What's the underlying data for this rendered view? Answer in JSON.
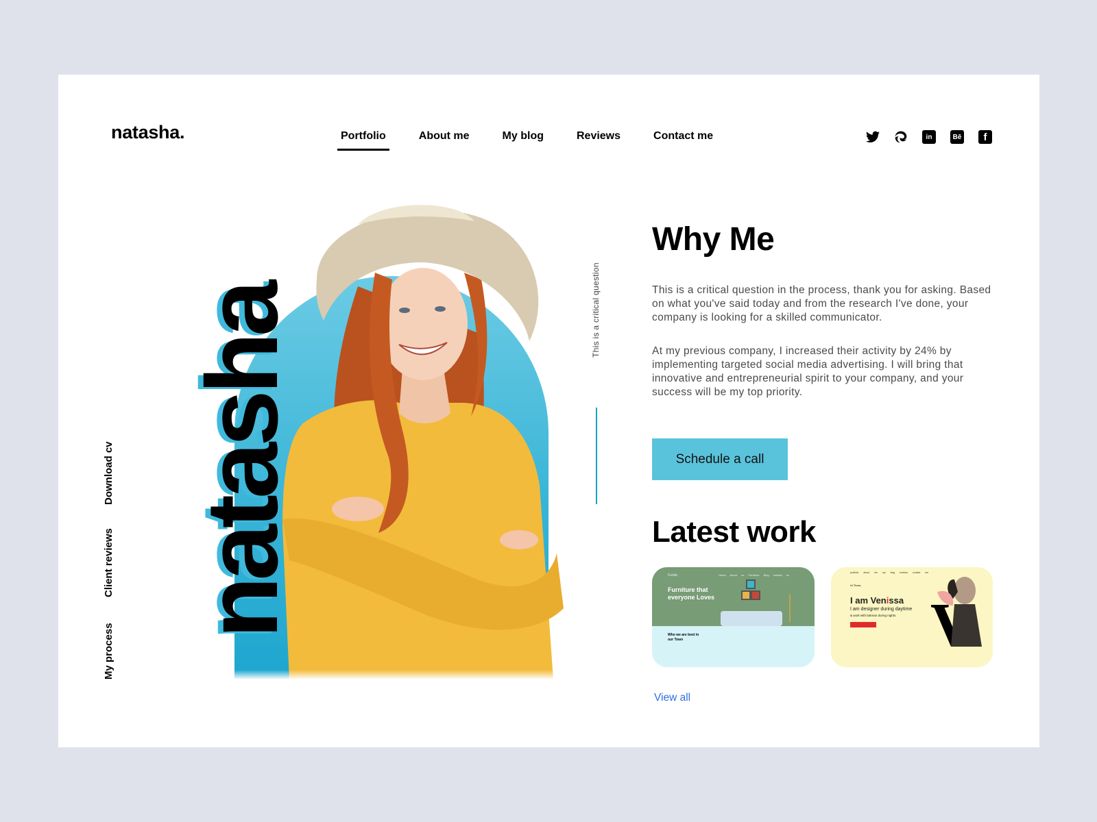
{
  "brand": {
    "logo": "natasha."
  },
  "nav": {
    "items": [
      {
        "label": "Portfolio",
        "active": true
      },
      {
        "label": "About me",
        "active": false
      },
      {
        "label": "My blog",
        "active": false
      },
      {
        "label": "Reviews",
        "active": false
      },
      {
        "label": "Contact me",
        "active": false
      }
    ]
  },
  "socials": [
    {
      "name": "twitter-icon"
    },
    {
      "name": "edge-icon"
    },
    {
      "name": "linkedin-icon",
      "glyph": "in"
    },
    {
      "name": "behance-icon",
      "glyph": "Bē"
    },
    {
      "name": "facebook-icon",
      "glyph": "f"
    }
  ],
  "side_links": [
    "My process",
    "Client reviews",
    "Download cv"
  ],
  "hero": {
    "big_name": "natasha",
    "vertical_caption": "This is a critical question"
  },
  "why_me": {
    "title": "Why Me",
    "paragraph_1": "This is a critical question in the process, thank you for asking. Based on what you've said today and from the research I've done, your company is looking for a skilled communicator.",
    "paragraph_2": "At my previous company, I increased their activity by 24% by implementing targeted social media advertising. I will bring that innovative and entrepreneurial spirit to your company, and your success will be my top priority.",
    "cta_label": "Schedule a call"
  },
  "latest_work": {
    "title": "Latest work",
    "view_all": "View all",
    "projects": [
      {
        "brand": "Fundo",
        "nav": "Home About us Furniture Blog contact us",
        "headline": "Furniture that everyone Loves",
        "subheading": "Who we are best in our Town"
      },
      {
        "nav": "portfolio about me my blog reviews contact me",
        "greeting": "Hi There,",
        "name_prefix": "I am Ven",
        "name_highlight": "i",
        "name_suffix": "ssa",
        "role": "I am designer during daytime",
        "role_2": "& work with batman during nights.",
        "monogram": "V"
      }
    ]
  },
  "colors": {
    "accent": "#5ac3dc",
    "accent_line": "#12a3c3",
    "link": "#2f6fe0",
    "page_bg": "#dfe2ea"
  }
}
